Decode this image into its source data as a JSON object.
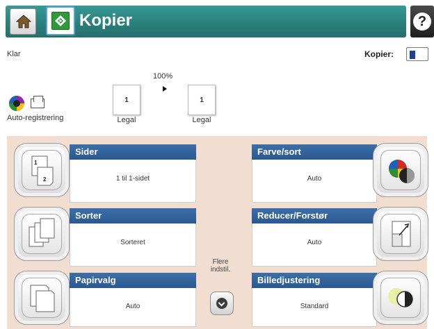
{
  "header": {
    "title": "Kopier",
    "home_icon": "home-icon",
    "app_icon": "copy-start-icon",
    "help_icon": "help-icon",
    "help_glyph": "?",
    "colors": {
      "bar": "#2a807c",
      "app_icon_bg": "#2e9a3a",
      "help_bg": "#2a2a2a"
    }
  },
  "status": {
    "text": "Klar",
    "copies_label": "Kopier:",
    "copies_value": "1"
  },
  "preview": {
    "mode_label": "Auto-registrering",
    "mode_icons": [
      "color-mode-icon",
      "document-icon"
    ],
    "zoom": "100%",
    "original": {
      "count": "1",
      "size": "Legal"
    },
    "output": {
      "count": "1",
      "size": "Legal"
    }
  },
  "options": {
    "sider": {
      "label": "Sider",
      "value": "1 til 1-sidet",
      "icon": "one-to-one-sided-icon"
    },
    "sorter": {
      "label": "Sorter",
      "value": "Sorteret",
      "icon": "collate-icon"
    },
    "papirvalg": {
      "label": "Papirvalg",
      "value": "Auto",
      "icon": "paper-select-icon"
    },
    "farve": {
      "label": "Farve/sort",
      "value": "Auto",
      "icon": "color-black-icon"
    },
    "reducer": {
      "label": "Reducer/Forstør",
      "value": "Auto",
      "icon": "reduce-enlarge-icon"
    },
    "billed": {
      "label": "Billedjustering",
      "value": "Standard",
      "icon": "image-adjust-icon"
    },
    "more": {
      "label": "Flere indstil.",
      "icon": "chevron-down-icon"
    }
  },
  "colors": {
    "panel_bg": "#f2ddd1",
    "option_header": "#2b5891"
  }
}
